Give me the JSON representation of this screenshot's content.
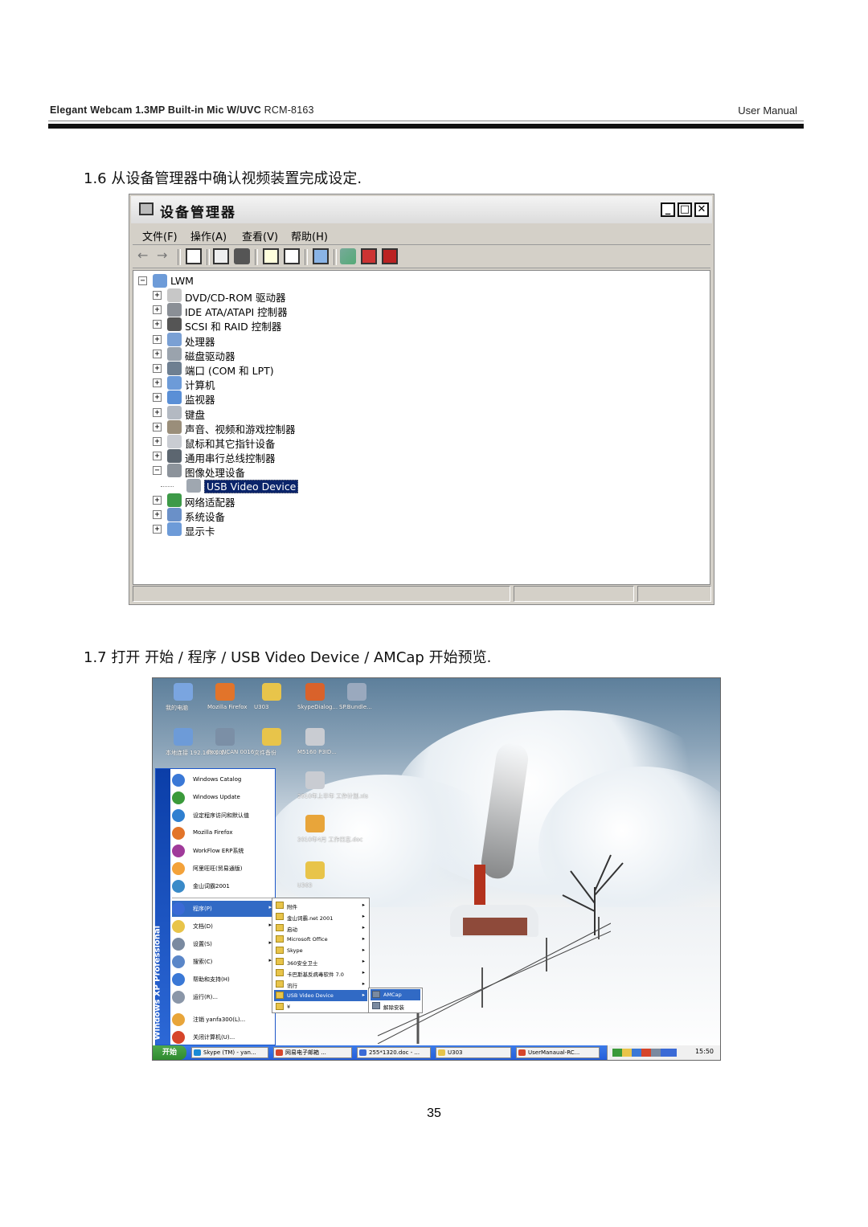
{
  "header": {
    "product": "Elegant  Webcam  1.3MP  Built-in  Mic  W/UVC",
    "model": "RCM-8163",
    "doc_type": "User  Manual"
  },
  "step_16": "1.6 从设备管理器中确认视频装置完成设定.",
  "step_17": "1.7 打开  开始  /  程序  / USB Video Device / AMCap  开始预览.",
  "page_number": "35",
  "device_manager": {
    "title": "设备管理器",
    "buttons": {
      "minimize": "_",
      "maximize": "□",
      "close": "✕"
    },
    "menu": [
      "文件(F)",
      "操作(A)",
      "查看(V)",
      "帮助(H)"
    ],
    "root": "LWM",
    "nodes": [
      {
        "label": "DVD/CD-ROM 驱动器",
        "icon": "cdrom-icon",
        "color": "#c7c7c7",
        "expander": "+"
      },
      {
        "label": "IDE ATA/ATAPI 控制器",
        "icon": "ide-controller-icon",
        "color": "#8a8f96",
        "expander": "+"
      },
      {
        "label": "SCSI 和 RAID 控制器",
        "icon": "scsi-icon",
        "color": "#555555",
        "expander": "+"
      },
      {
        "label": "处理器",
        "icon": "processor-icon",
        "color": "#7aa0d4",
        "expander": "+"
      },
      {
        "label": "磁盘驱动器",
        "icon": "disk-drive-icon",
        "color": "#9aa3ad",
        "expander": "+"
      },
      {
        "label": "端口 (COM 和 LPT)",
        "icon": "port-icon",
        "color": "#6e7f91",
        "expander": "+"
      },
      {
        "label": "计算机",
        "icon": "computer-icon",
        "color": "#6d9bd8",
        "expander": "+"
      },
      {
        "label": "监视器",
        "icon": "monitor-icon",
        "color": "#5a8fd6",
        "expander": "+"
      },
      {
        "label": "键盘",
        "icon": "keyboard-icon",
        "color": "#b3b9c2",
        "expander": "+"
      },
      {
        "label": "声音、视频和游戏控制器",
        "icon": "sound-icon",
        "color": "#9a8e7a",
        "expander": "+"
      },
      {
        "label": "鼠标和其它指针设备",
        "icon": "mouse-icon",
        "color": "#c9ccd2",
        "expander": "+"
      },
      {
        "label": "通用串行总线控制器",
        "icon": "usb-icon",
        "color": "#5c6670",
        "expander": "+"
      },
      {
        "label": "图像处理设备",
        "icon": "imaging-device-icon",
        "color": "#8c939b",
        "expander": "−"
      },
      {
        "label": "USB Video Device",
        "icon": "camera-icon",
        "color": "#9fa7b0",
        "expander": "",
        "child": true,
        "selected": true
      },
      {
        "label": "网络适配器",
        "icon": "network-adapter-icon",
        "color": "#3d9a48",
        "expander": "+"
      },
      {
        "label": "系统设备",
        "icon": "system-device-icon",
        "color": "#6a90c8",
        "expander": "+"
      },
      {
        "label": "显示卡",
        "icon": "display-adapter-icon",
        "color": "#6d9bd8",
        "expander": "+"
      }
    ]
  },
  "desktop": {
    "icons": [
      {
        "label": "我的电脑",
        "color": "#7aa5e0"
      },
      {
        "label": "Mozilla Firefox",
        "color": "#e2742a"
      },
      {
        "label": "U303",
        "color": "#e8c44a"
      },
      {
        "label": "SkypeDialog...",
        "color": "#d9622b"
      },
      {
        "label": "SP.Bundle...",
        "color": "#9aa9be"
      },
      {
        "label": "本地连接 192.168.1.1...",
        "color": "#6d9bd8"
      },
      {
        "label": "ProtoNCAN 0016...",
        "color": "#7b8fa6"
      },
      {
        "label": "文件备份",
        "color": "#e8c44a"
      },
      {
        "label": "M5160 P3ID...",
        "color": "#c9ccd2"
      },
      {
        "label": "2010年上半年 工作计划.xls",
        "color": "#c9ccd2"
      },
      {
        "label": "2010年4月 工作日志.doc",
        "color": "#e8a53a"
      },
      {
        "label": "U303",
        "color": "#e8c44a"
      }
    ],
    "start_menu": {
      "side_text": "Windows XP  Professional",
      "pinned": [
        {
          "label": "Windows Catalog",
          "icon": "windows-catalog-icon",
          "color": "#3a78d6"
        },
        {
          "label": "Windows Update",
          "icon": "windows-update-icon",
          "color": "#3a9a3a"
        },
        {
          "label": "设定程序访问和默认值",
          "icon": "program-access-icon",
          "color": "#2f7fd0"
        },
        {
          "label": "Mozilla Firefox",
          "icon": "firefox-icon",
          "color": "#e2742a"
        },
        {
          "label": "WorkFlow ERP系统",
          "icon": "erp-icon",
          "color": "#a03a9a"
        },
        {
          "label": "阿里旺旺(贸易通版)",
          "icon": "aliwangwang-icon",
          "color": "#f3a23a"
        },
        {
          "label": "金山词霸2001",
          "icon": "kingsoft-icon",
          "color": "#3a8ac8"
        }
      ],
      "items": [
        {
          "label": "程序(P)",
          "icon": "programs-icon",
          "color": "#3a6ad6",
          "arrow": "▸",
          "hl": true
        },
        {
          "label": "文档(D)",
          "icon": "documents-icon",
          "color": "#e8c44a",
          "arrow": "▸"
        },
        {
          "label": "设置(S)",
          "icon": "settings-icon",
          "color": "#7a8aa0",
          "arrow": "▸"
        },
        {
          "label": "搜索(C)",
          "icon": "search-icon",
          "color": "#5a86c8",
          "arrow": "▸"
        },
        {
          "label": "帮助和支持(H)",
          "icon": "help-icon",
          "color": "#3a78d6",
          "arrow": ""
        },
        {
          "label": "运行(R)...",
          "icon": "run-icon",
          "color": "#8a96a8",
          "arrow": ""
        },
        {
          "label": "注销 yanfa300(L)...",
          "icon": "logoff-icon",
          "color": "#e8a53a",
          "arrow": ""
        },
        {
          "label": "关闭计算机(U)...",
          "icon": "shutdown-icon",
          "color": "#d6452a",
          "arrow": ""
        }
      ]
    },
    "programs_menu": [
      {
        "label": "附件",
        "arrow": "▸"
      },
      {
        "label": "金山词霸.net 2001",
        "arrow": "▸"
      },
      {
        "label": "启动",
        "arrow": "▸"
      },
      {
        "label": "Microsoft Office",
        "arrow": "▸"
      },
      {
        "label": "Skype",
        "arrow": "▸"
      },
      {
        "label": "360安全卫士",
        "arrow": "▸"
      },
      {
        "label": "卡巴斯基反病毒软件 7.0",
        "arrow": "▸"
      },
      {
        "label": "讯行",
        "arrow": "▸"
      },
      {
        "label": "USB Video Device",
        "arrow": "▸",
        "hl": true
      },
      {
        "label": "¥",
        "arrow": ""
      }
    ],
    "usb_menu": [
      {
        "label": "AMCap",
        "hl": true
      },
      {
        "label": "解除安装"
      }
    ],
    "taskbar": {
      "start_label": "开始",
      "tasks": [
        {
          "label": "Skype (TM) - yan...",
          "color": "#1a8ad6"
        },
        {
          "label": "网易电子邮箱 ...",
          "color": "#d6452a"
        },
        {
          "label": "255*1320.doc - ...",
          "color": "#3a6ad6"
        },
        {
          "label": "U303",
          "color": "#e8c44a"
        },
        {
          "label": "UserManaual-RC...",
          "color": "#d6452a"
        }
      ],
      "clock": "15:50"
    }
  }
}
